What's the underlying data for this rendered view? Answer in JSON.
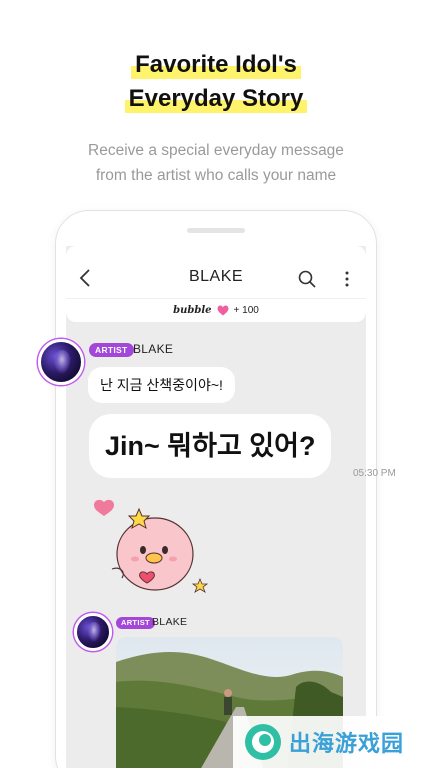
{
  "promo": {
    "headline_line1": "Favorite Idol's",
    "headline_line2": "Everyday Story",
    "subtitle_line1": "Receive a special everyday message",
    "subtitle_line2": "from the artist who calls your name",
    "highlight_color": "#fff36b"
  },
  "chat": {
    "title": "BLAKE",
    "bubble_label": "bubble",
    "bubble_count": "+ 100",
    "heart_color": "#f0609e",
    "messages": [
      {
        "badge": "ARTIST",
        "sender": "BLAKE",
        "text": "난 지금 산책중이야~!"
      },
      {
        "text": "Jin~ 뭐하고 있어?",
        "time": "05:30 PM"
      },
      {
        "type": "sticker",
        "name": "pink-character-sticker"
      },
      {
        "badge": "ARTIST",
        "sender": "BLAKE",
        "type": "photo",
        "name": "landscape-photo"
      }
    ],
    "badge_color": "#a347d9"
  },
  "watermark": {
    "text": "出海游戏园"
  }
}
